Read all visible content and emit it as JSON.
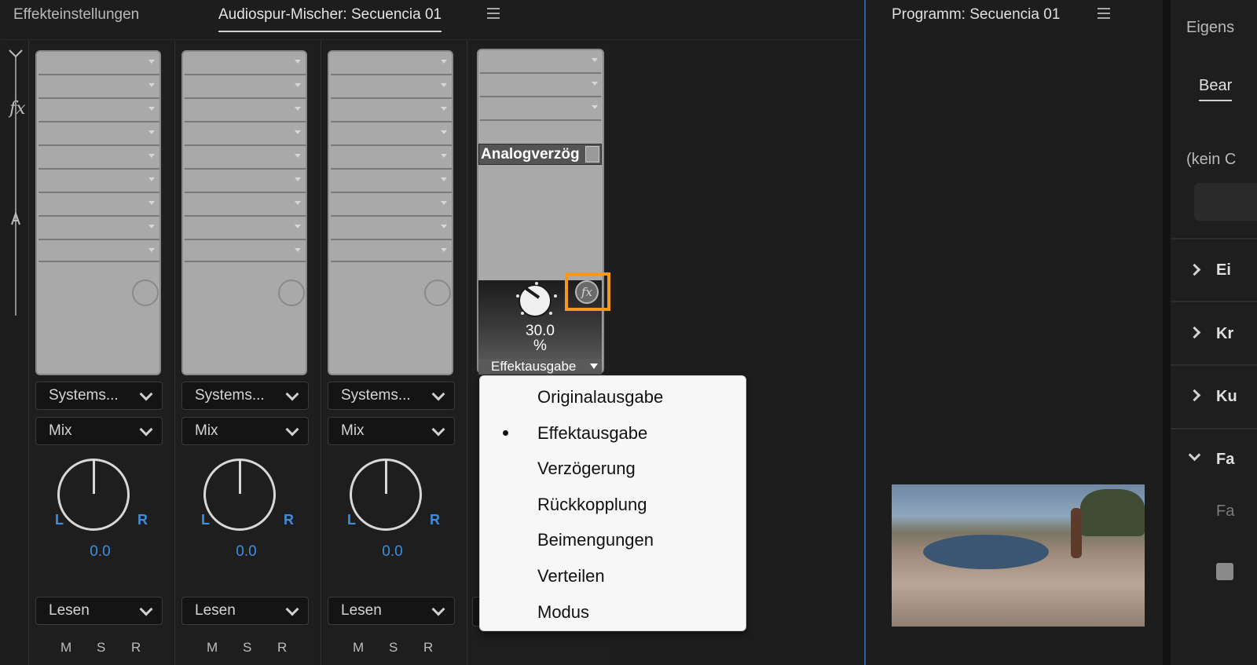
{
  "tabs": {
    "effect_settings": "Effekteinstellungen",
    "audio_mixer": "Audiospur-Mischer: Secuencia 01",
    "program": "Programm: Secuencia 01"
  },
  "tracks": [
    {
      "output": "Systems...",
      "mode": "Mix",
      "pan_L": "L",
      "pan_R": "R",
      "pan_value": "0.0",
      "automation": "Lesen",
      "m": "M",
      "s": "S",
      "r": "R"
    },
    {
      "output": "Systems...",
      "mode": "Mix",
      "pan_L": "L",
      "pan_R": "R",
      "pan_value": "0.0",
      "automation": "Lesen",
      "m": "M",
      "s": "S",
      "r": "R"
    },
    {
      "output": "Systems...",
      "mode": "Mix",
      "pan_L": "L",
      "pan_R": "R",
      "pan_value": "0.0",
      "automation": "Lesen",
      "m": "M",
      "s": "S",
      "r": "R"
    }
  ],
  "effect_editor": {
    "effect_name": "Analogverzög",
    "value": "30.0",
    "unit": "%",
    "parameter": "Effektausgabe",
    "fx_glyph": "fx"
  },
  "rail": {
    "fx_glyph": "fx"
  },
  "dropdown": {
    "items": [
      "Originalausgabe",
      "Effektausgabe",
      "Verzögerung",
      "Rückkopplung",
      "Beimengungen",
      "Verteilen",
      "Modus"
    ],
    "selected": "Effektausgabe"
  },
  "properties": {
    "title_partial": "Eigens",
    "tab_partial": "Bear",
    "none_partial": "(kein C",
    "sections": [
      "Ei",
      "Kr",
      "Ku",
      "Fa"
    ],
    "sub_partial": "Fa"
  },
  "colors": {
    "accent_blue": "#3d8edc",
    "highlight_orange": "#f39a1e"
  }
}
